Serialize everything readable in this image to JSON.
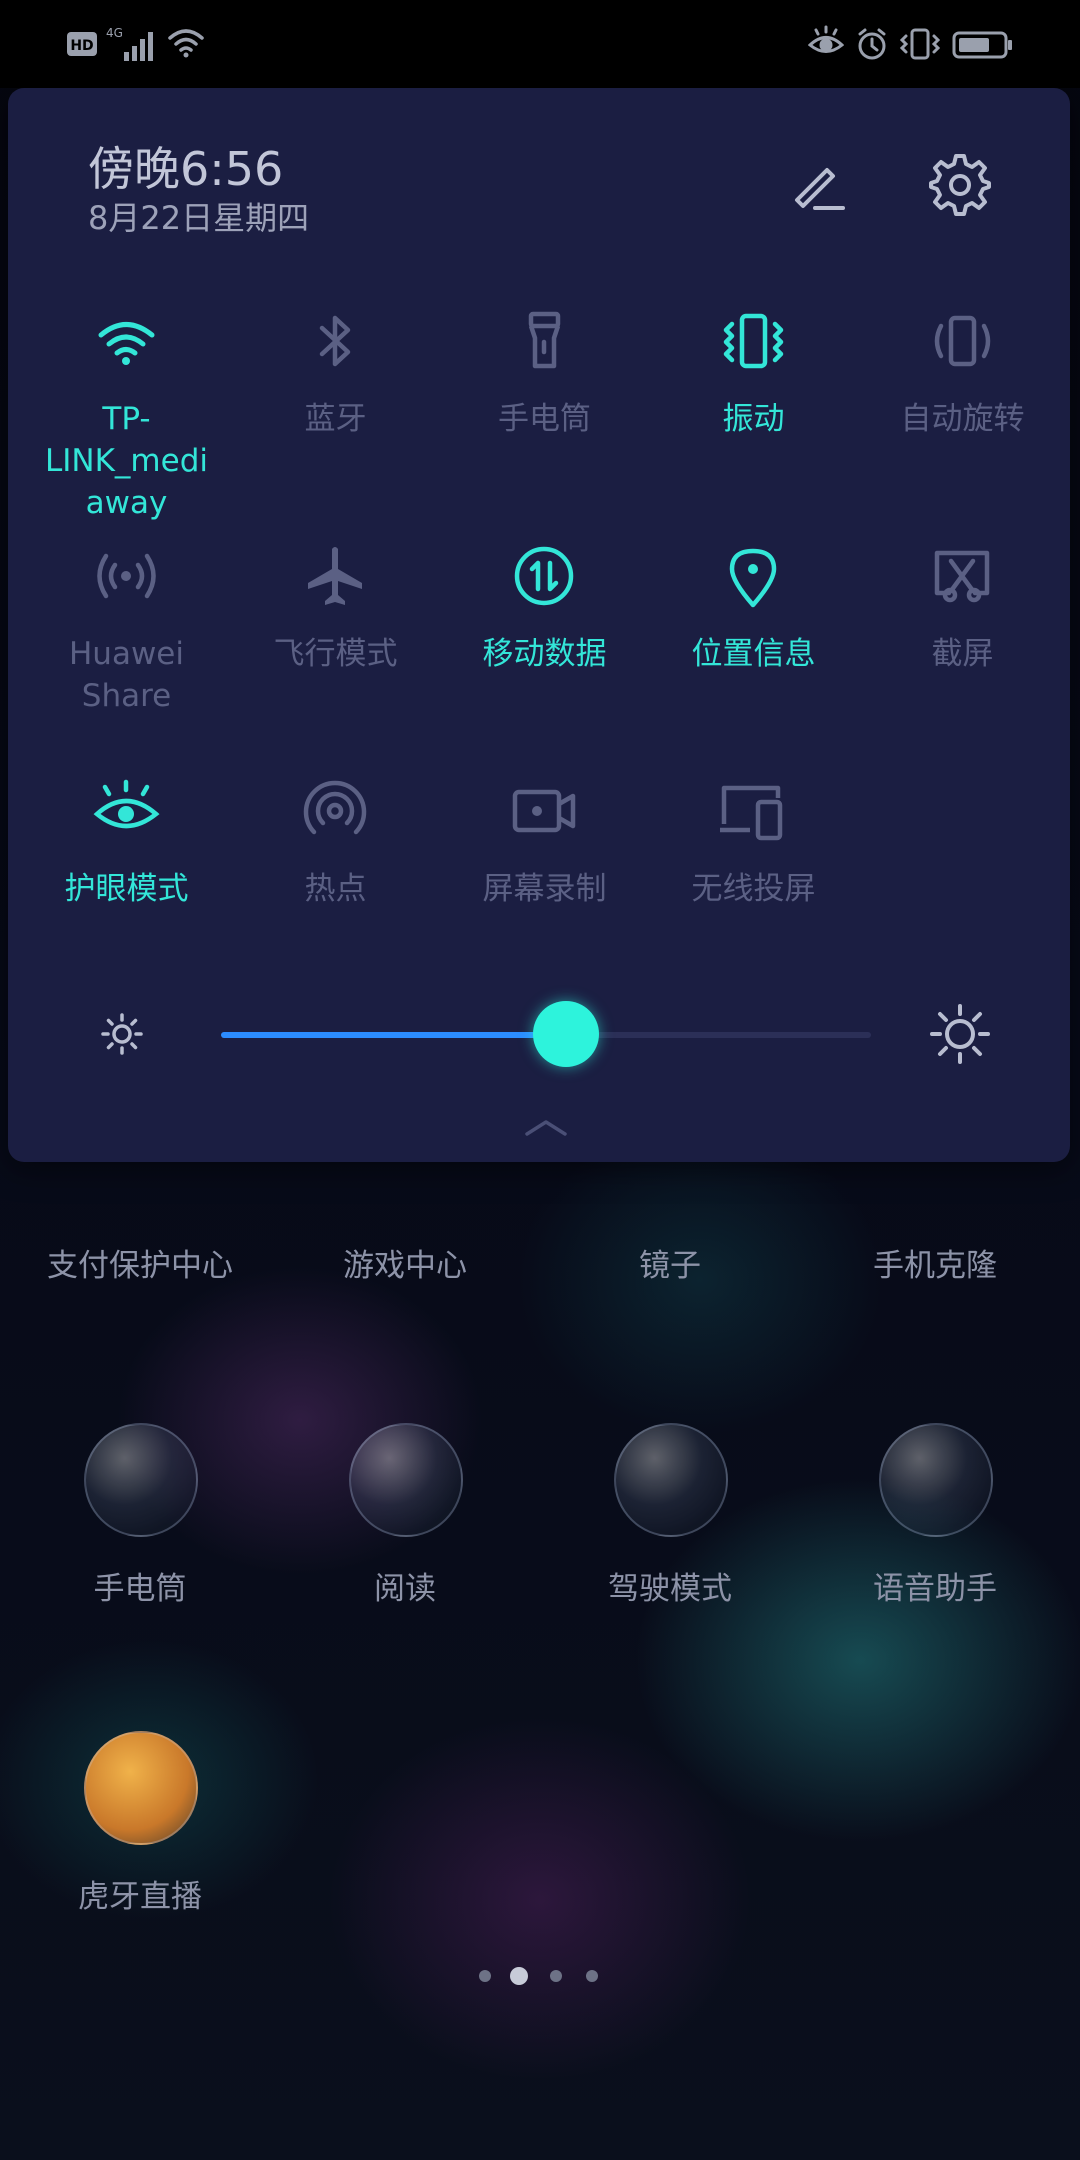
{
  "status_bar": {
    "left_icons": [
      "hd-icon",
      "4g-signal-icon",
      "wifi-signal-icon"
    ],
    "hd_label": "HD",
    "network_label": "4G",
    "right_icons": [
      "eye-comfort-icon",
      "alarm-icon",
      "vibrate-icon",
      "battery-icon"
    ]
  },
  "panel": {
    "time": "傍晚6:56",
    "date": "8月22日星期四",
    "edit_icon": "pencil-icon",
    "settings_icon": "gear-icon",
    "accent_color": "#33e6d8",
    "tiles": [
      {
        "label": "TP-LINK_medi away",
        "label_line1": "TP-LINK_medi",
        "label_line2": "away",
        "icon": "wifi-icon",
        "active": true
      },
      {
        "label": "蓝牙",
        "icon": "bluetooth-icon",
        "active": false
      },
      {
        "label": "手电筒",
        "icon": "flashlight-icon",
        "active": false
      },
      {
        "label": "振动",
        "icon": "vibrate-icon",
        "active": true
      },
      {
        "label": "自动旋转",
        "icon": "auto-rotate-icon",
        "active": false
      },
      {
        "label": "Huawei Share",
        "icon": "huawei-share-icon",
        "active": false
      },
      {
        "label": "飞行模式",
        "icon": "airplane-icon",
        "active": false
      },
      {
        "label": "移动数据",
        "icon": "mobile-data-icon",
        "active": true
      },
      {
        "label": "位置信息",
        "icon": "location-icon",
        "active": true
      },
      {
        "label": "截屏",
        "icon": "screenshot-icon",
        "active": false
      },
      {
        "label": "护眼模式",
        "icon": "eye-comfort-icon",
        "active": true
      },
      {
        "label": "热点",
        "icon": "hotspot-icon",
        "active": false
      },
      {
        "label": "屏幕录制",
        "icon": "screen-record-icon",
        "active": false
      },
      {
        "label": "无线投屏",
        "icon": "wireless-projection-icon",
        "active": false
      }
    ],
    "brightness": {
      "value": 0.53,
      "min_icon": "brightness-low-icon",
      "max_icon": "brightness-high-icon"
    }
  },
  "home": {
    "apps": [
      {
        "name": "支付保护中心"
      },
      {
        "name": "游戏中心"
      },
      {
        "name": "镜子"
      },
      {
        "name": "手机克隆"
      },
      {
        "name": "手电筒"
      },
      {
        "name": "阅读"
      },
      {
        "name": "驾驶模式"
      },
      {
        "name": "语音助手"
      },
      {
        "name": "虎牙直播"
      }
    ],
    "page_indicator": {
      "pages": 4,
      "current": 2
    }
  }
}
